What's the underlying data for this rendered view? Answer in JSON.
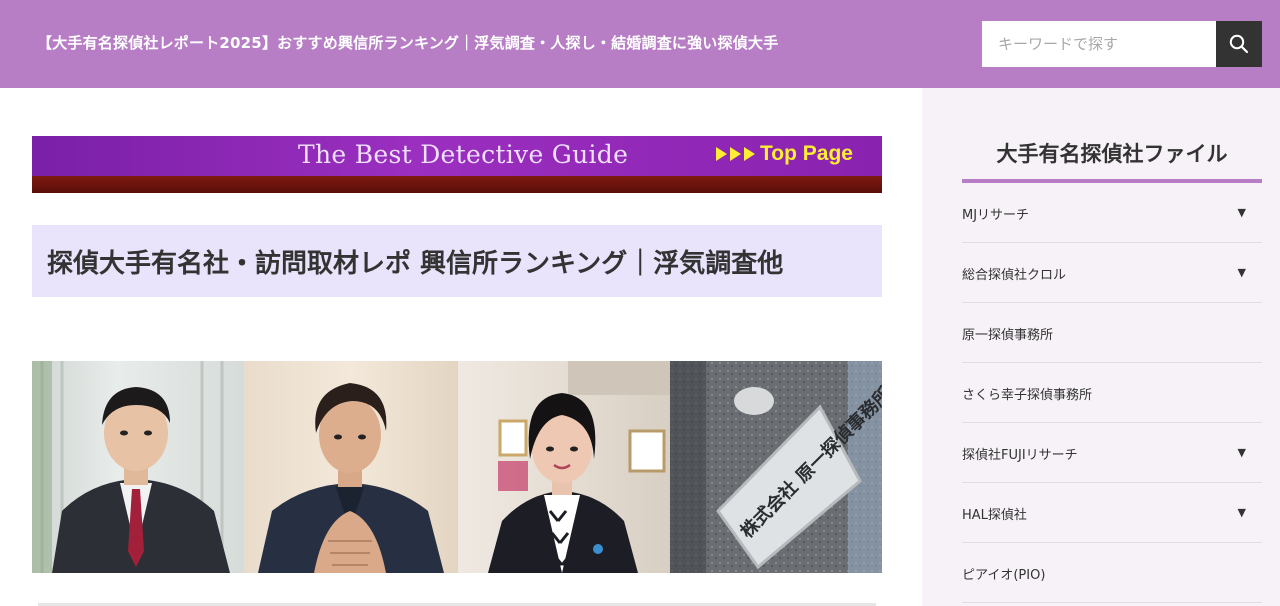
{
  "header": {
    "site_title": "【大手有名探偵社レポート2025】おすすめ興信所ランキング｜浮気調査・人探し・結婚調査に強い探偵大手",
    "search_placeholder": "キーワードで探す",
    "search_icon": "search-icon",
    "background_color": "#b77ec6"
  },
  "main": {
    "banner": {
      "guide_text": "The Best Detective Guide",
      "top_page_text": "Top Page",
      "arrow_icon": "triple-arrow-icon"
    },
    "page_title": "探偵大手有名社・訪問取材レポ 興信所ランキング｜浮気調査他",
    "page_title_bg": "#e9e3fb",
    "photo_strip": {
      "sign_text": "株式会社 原一探偵事務所"
    }
  },
  "sidebar": {
    "heading": "大手有名探偵社ファイル",
    "accent_color": "#b77ec6",
    "items": [
      {
        "label": "MJリサーチ",
        "caret": "▼"
      },
      {
        "label": "総合探偵社クロル",
        "caret": "▼"
      },
      {
        "label": "原一探偵事務所",
        "caret": ""
      },
      {
        "label": "さくら幸子探偵事務所",
        "caret": ""
      },
      {
        "label": "探偵社FUJIリサーチ",
        "caret": "▼"
      },
      {
        "label": "HAL探偵社",
        "caret": "▼"
      },
      {
        "label": "ピアイオ(PIO)",
        "caret": ""
      }
    ]
  }
}
